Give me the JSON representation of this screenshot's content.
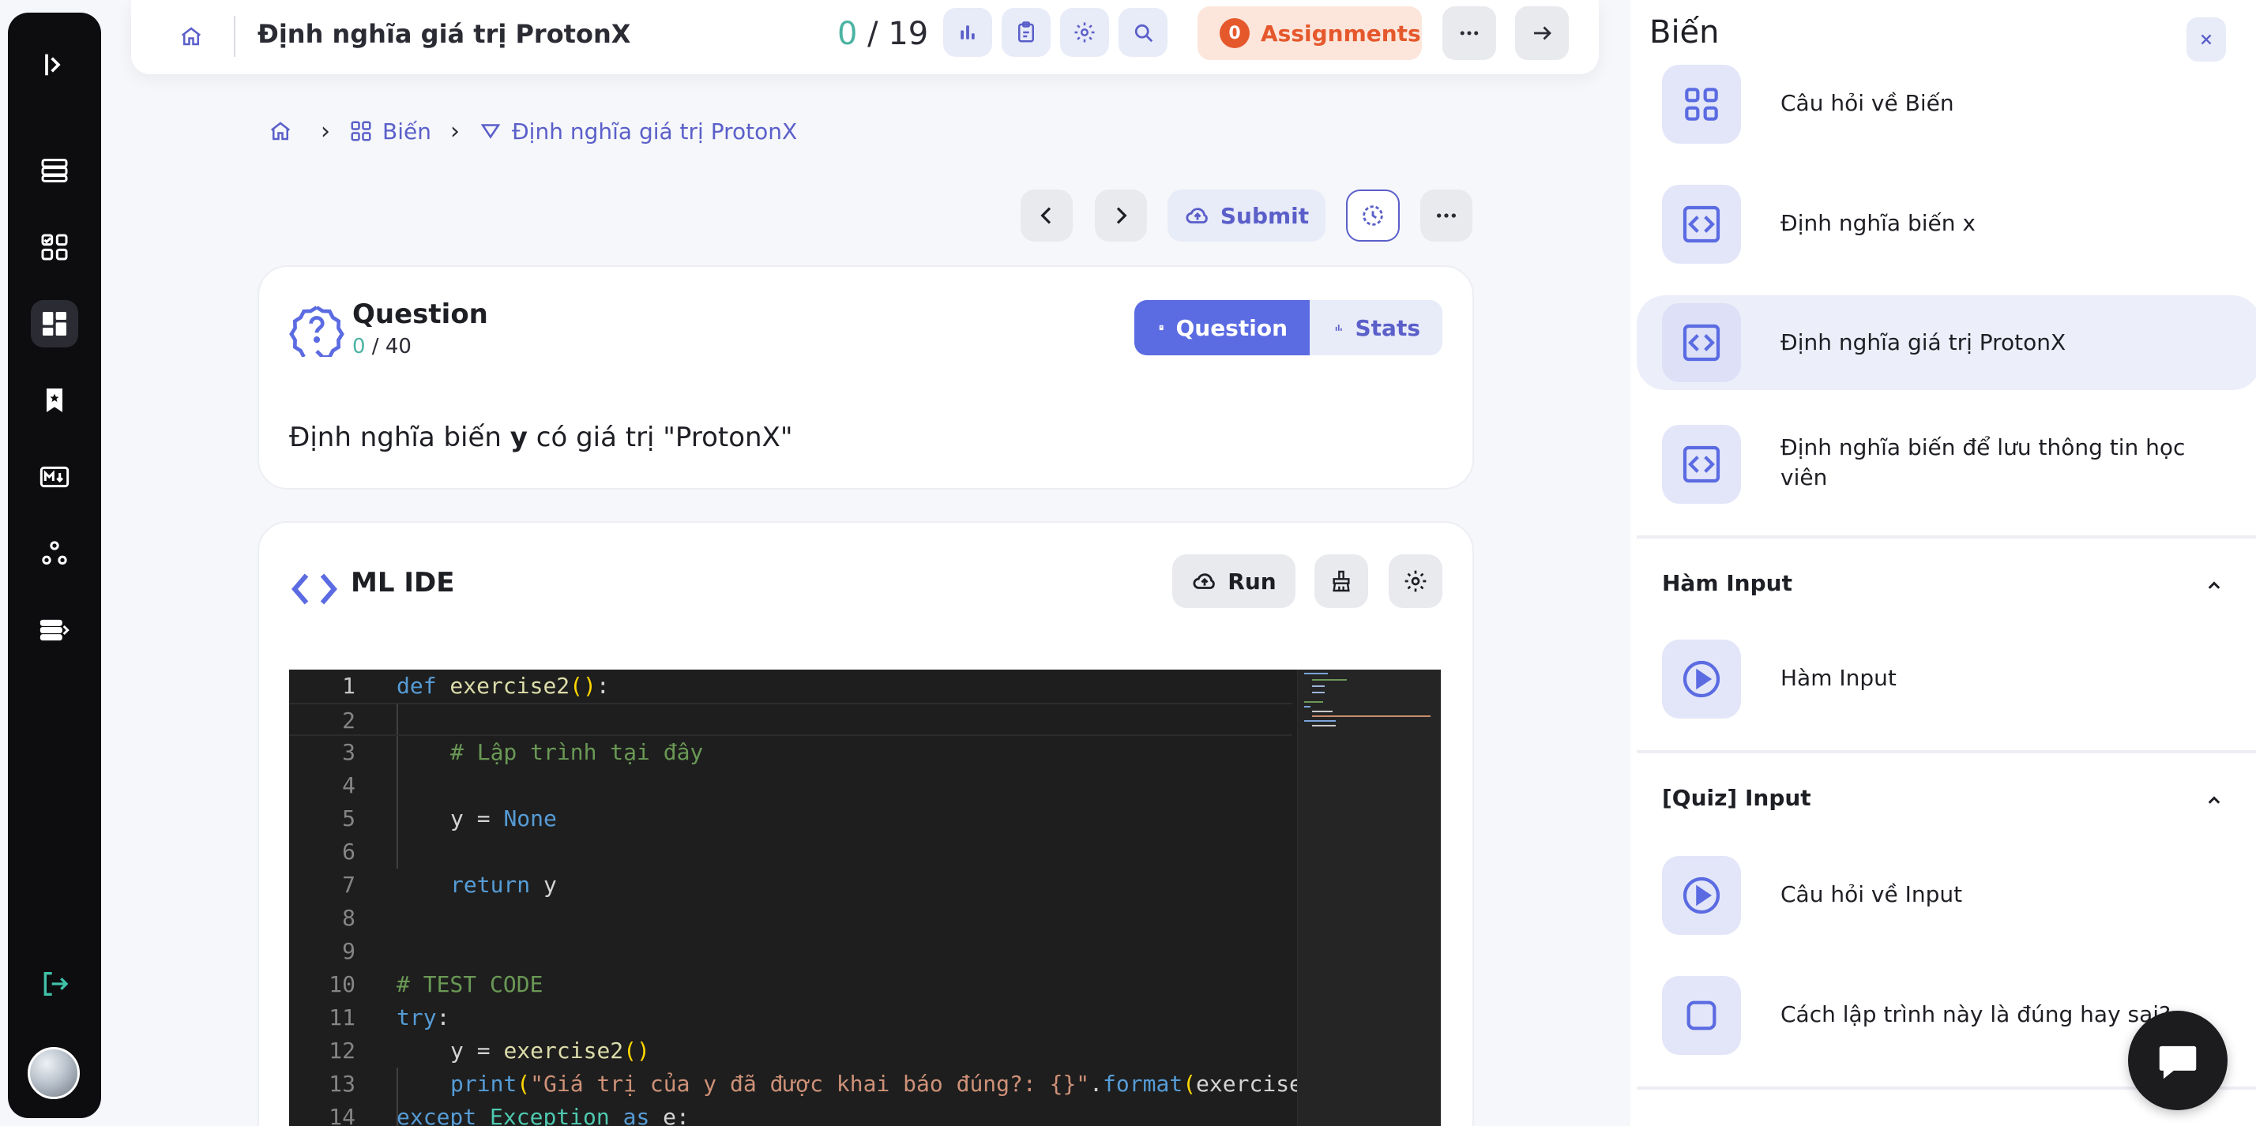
{
  "topbar": {
    "title": "Định nghĩa giá trị ProtonX",
    "score_done": "0",
    "score_total": " / 19",
    "assignments_count": "0",
    "assignments_label": "Assignments"
  },
  "breadcrumb": {
    "item1": "Biến",
    "item2": "Định nghĩa giá trị ProtonX"
  },
  "actions": {
    "submit_label": "Submit"
  },
  "question": {
    "title": "Question",
    "score_done": "0",
    "score_total": " / 40",
    "tab_question": "Question",
    "tab_stats": "Stats",
    "text_before": "Định nghĩa biến ",
    "text_bold": "y",
    "text_after": " có giá trị \"ProtonX\""
  },
  "ide": {
    "title": "ML IDE",
    "run_label": "Run",
    "lines": [
      {
        "n": "1"
      },
      {
        "n": "2"
      },
      {
        "n": "3"
      },
      {
        "n": "4"
      },
      {
        "n": "5"
      },
      {
        "n": "6"
      },
      {
        "n": "7"
      },
      {
        "n": "8"
      },
      {
        "n": "9"
      },
      {
        "n": "10"
      },
      {
        "n": "11"
      },
      {
        "n": "12"
      },
      {
        "n": "13"
      },
      {
        "n": "14"
      }
    ],
    "code": {
      "l1_def": "def",
      "l1_name": " exercise2",
      "l1_paren": "()",
      "l1_colon": ":",
      "l3": "# Lập trình tại đây",
      "l5_a": "y = ",
      "l5_b": "None",
      "l7_a": "return",
      "l7_b": " y",
      "l10": "# TEST CODE",
      "l11_a": "try",
      "l11_b": ":",
      "l12_a": "y = ",
      "l12_b": "exercise2",
      "l12_c": "()",
      "l13_a": "print",
      "l13_b": "(",
      "l13_c": "\"Giá trị của y đã được khai báo đúng?: {}\"",
      "l13_d": ".",
      "l13_e": "format",
      "l13_f": "(",
      "l13_g": "exercise",
      "l14_a": "except",
      "l14_b": " Exception ",
      "l14_c": "as",
      "l14_d": " e:"
    }
  },
  "panel": {
    "title": "Biến",
    "items": [
      {
        "label": "Câu hỏi về Biến"
      },
      {
        "label": "Định nghĩa biến x"
      },
      {
        "label": "Định nghĩa giá trị ProtonX"
      },
      {
        "label": "Định nghĩa biến để lưu thông tin học viên"
      },
      {
        "label": "Hàm Input"
      },
      {
        "label": "Câu hỏi về Input"
      },
      {
        "label": "Cách lập trình này là đúng hay sai?"
      }
    ],
    "sections": [
      {
        "label": "Hàm Input"
      },
      {
        "label": "[Quiz] Input"
      }
    ]
  },
  "colors": {
    "accent": "#5b6be2",
    "accent_soft": "#e8ebf8",
    "success": "#4bb3a3",
    "warning": "#e5582c",
    "rail": "#0d0d10",
    "editor_bg": "#1e1e1e"
  },
  "icons": {
    "rail": [
      "sidebar-expand-icon",
      "database-icon",
      "checklist-icon",
      "dashboard-icon",
      "bookmark-icon",
      "markdown-icon",
      "network-icon",
      "list-expand-icon",
      "logout-icon"
    ],
    "topbar": [
      "home-icon",
      "chart-icon",
      "clipboard-icon",
      "gear-icon",
      "search-icon",
      "more-icon",
      "arrow-right-icon"
    ]
  }
}
